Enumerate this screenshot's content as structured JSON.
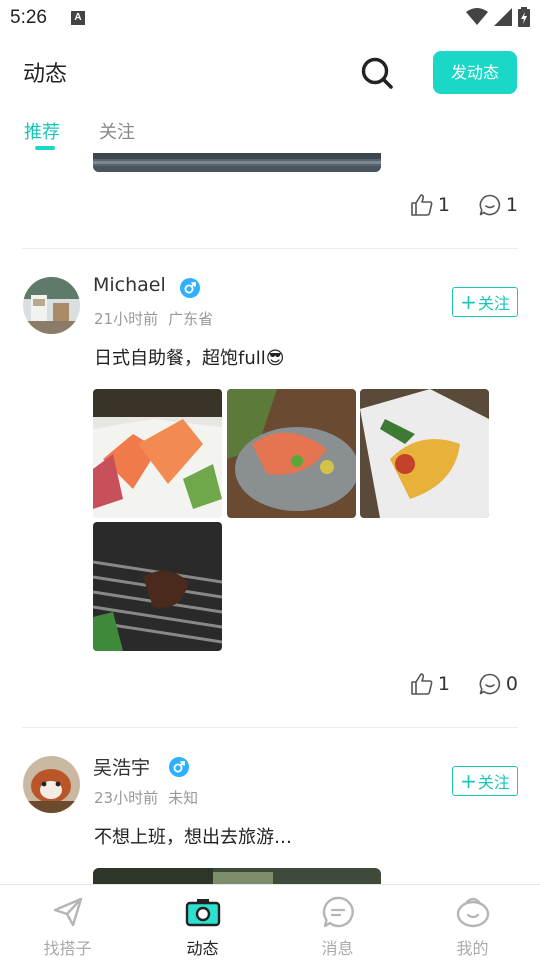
{
  "status_bar": {
    "time": "5:26",
    "app_badge": "A"
  },
  "header": {
    "title": "动态",
    "post_button": "发动态"
  },
  "tabs": [
    {
      "label": "推荐",
      "active": true
    },
    {
      "label": "关注",
      "active": false
    }
  ],
  "feed": [
    {
      "likes": "1",
      "comments": "1"
    },
    {
      "user": "Michael",
      "gender": "male",
      "time": "21小时前",
      "location": "广东省",
      "follow_label": "关注",
      "text": "日式自助餐，超饱full😎",
      "images": [
        "salmon-shrimp-sashimi",
        "sweet-shrimp-plate",
        "grilled-cheese-lobster",
        "bbq-meat-grill"
      ],
      "likes": "1",
      "comments": "0"
    },
    {
      "user": "吴浩宇",
      "gender": "male",
      "time": "23小时前",
      "location": "未知",
      "follow_label": "关注",
      "text": "不想上班，想出去旅游…"
    }
  ],
  "bottom_nav": [
    {
      "label": "找搭子",
      "icon": "paper-plane-icon",
      "active": false
    },
    {
      "label": "动态",
      "icon": "camera-icon",
      "active": true
    },
    {
      "label": "消息",
      "icon": "chat-bubble-icon",
      "active": false
    },
    {
      "label": "我的",
      "icon": "face-icon",
      "active": false
    }
  ],
  "colors": {
    "accent": "#1bd7c8",
    "gender_male": "#2fb0ff"
  }
}
